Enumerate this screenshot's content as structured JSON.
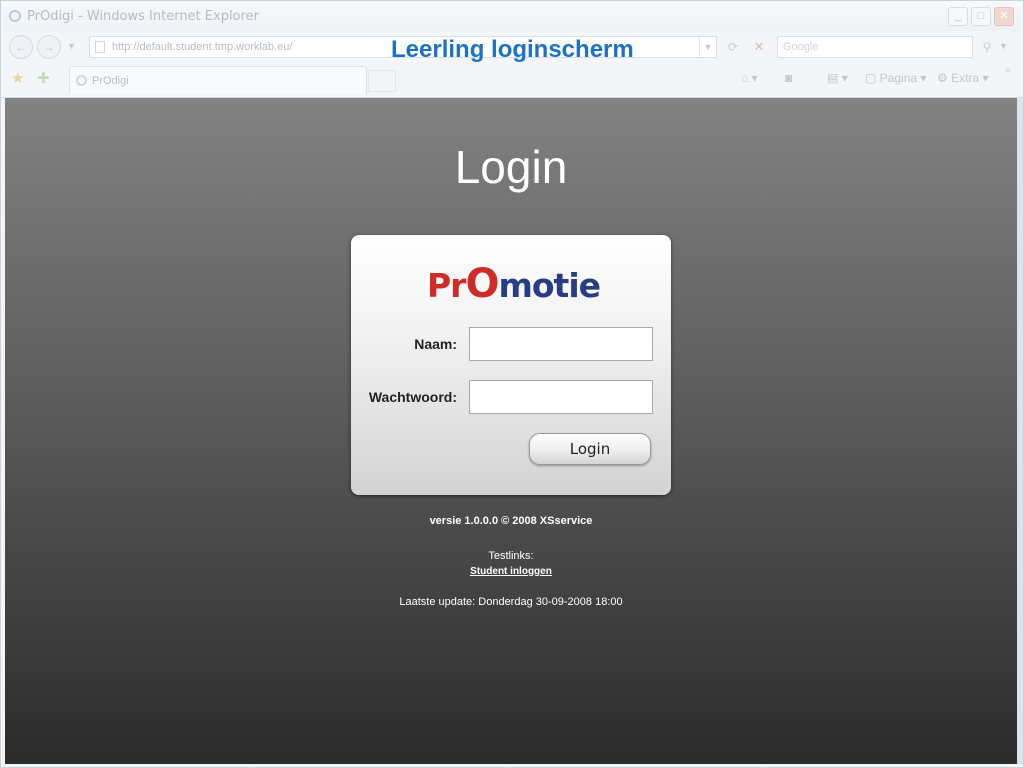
{
  "browser": {
    "window_title": "PrOdigi - Windows Internet Explorer",
    "address_url": "http://default.student.tmp.worklab.eu/",
    "search_placeholder": "Google",
    "tab_title": "PrOdigi",
    "commands": {
      "page": "Pagina",
      "tools": "Extra"
    }
  },
  "heading": "Leerling loginscherm",
  "login": {
    "title": "Login",
    "logo": {
      "pr": "Pr",
      "o": "O",
      "rest": "motie"
    },
    "name_label": "Naam:",
    "password_label": "Wachtwoord:",
    "name_value": "",
    "password_value": "",
    "button_label": "Login"
  },
  "footer": {
    "version": "versie 1.0.0.0 © 2008 XSservice",
    "testlinks_label": "Testlinks:",
    "testlink": "Student inloggen",
    "last_update": "Laatste update: Donderdag 30-09-2008 18:00"
  }
}
